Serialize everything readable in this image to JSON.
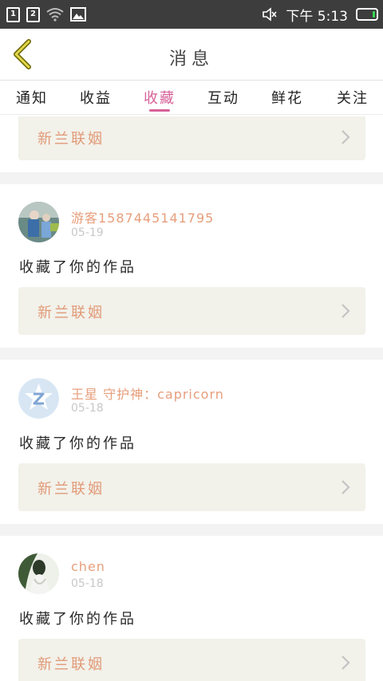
{
  "status_bar": {
    "sim1": "1",
    "sim2": "2",
    "time": "下午 5:13",
    "icons": [
      "sim1-icon",
      "sim2-icon",
      "wifi-icon",
      "image-icon",
      "mute-icon",
      "battery-icon"
    ]
  },
  "header": {
    "title": "消息"
  },
  "tabs": [
    {
      "label": "通知"
    },
    {
      "label": "收益"
    },
    {
      "label": "收藏",
      "active": true
    },
    {
      "label": "互动"
    },
    {
      "label": "鲜花"
    },
    {
      "label": "关注"
    }
  ],
  "accent_color": "#d76199",
  "name_color": "#e79e7b",
  "top_partial_card": {
    "work_title": "新兰联姻"
  },
  "items": [
    {
      "username": "游客1587445141795",
      "date": "05-19",
      "action": "收藏了你的作品",
      "work_title": "新兰联姻"
    },
    {
      "username": "王星 守护神：capricorn",
      "date": "05-18",
      "action": "收藏了你的作品",
      "work_title": "新兰联姻"
    },
    {
      "username": "chen",
      "date": "05-18",
      "action": "收藏了你的作品",
      "work_title": "新兰联姻"
    }
  ]
}
